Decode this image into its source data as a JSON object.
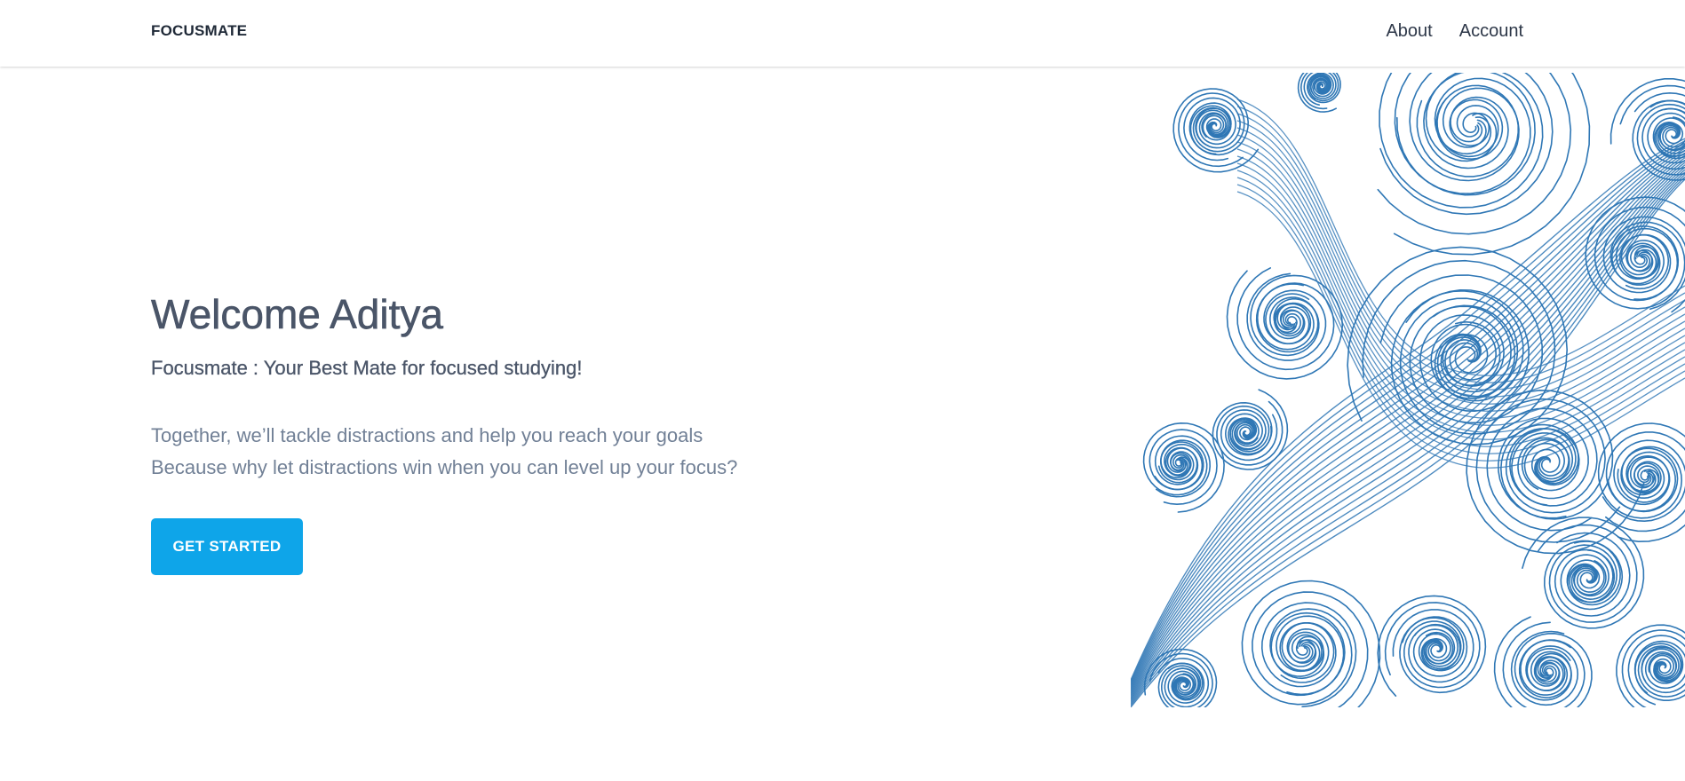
{
  "navbar": {
    "brand": "FOCUSMATE",
    "links": [
      {
        "label": "About"
      },
      {
        "label": "Account"
      }
    ]
  },
  "hero": {
    "title": "Welcome Aditya",
    "subtitle": "Focusmate : Your Best Mate for focused studying!",
    "body_lines": [
      "Together, we’ll tackle distractions and help you reach your goals",
      "Because why let distractions win when you can level up your focus?"
    ],
    "cta_label": "GET STARTED"
  },
  "illustration": {
    "name": "blue-swirl-waves-illustration",
    "color": "#2f77b5"
  },
  "colors": {
    "accent": "#0ea5e9",
    "heading": "#4a5568",
    "body": "#718096"
  }
}
